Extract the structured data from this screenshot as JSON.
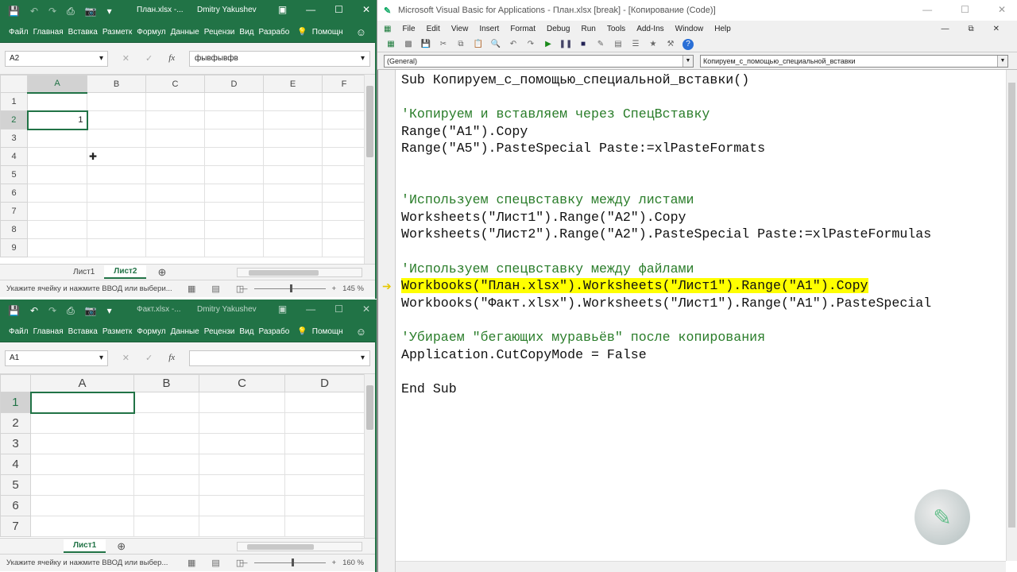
{
  "excel1": {
    "file": "План.xlsx -...",
    "user": "Dmitry Yakushev",
    "tabs": [
      "Файл",
      "Главная",
      "Вставка",
      "Разметк",
      "Формул",
      "Данные",
      "Рецензи",
      "Вид",
      "Разрабо"
    ],
    "tell": "Помощн",
    "namebox": "A2",
    "formula": "фывфывфв",
    "columns": [
      "A",
      "B",
      "C",
      "D",
      "E",
      "F"
    ],
    "rows": [
      "1",
      "2",
      "3",
      "4",
      "5",
      "6",
      "7",
      "8",
      "9"
    ],
    "a2": "1",
    "sheets": [
      "Лист1",
      "Лист2"
    ],
    "status": "Укажите ячейку и нажмите ВВОД или выбери...",
    "zoom": "145 %"
  },
  "excel2": {
    "file": "Факт.xlsx -...",
    "user": "Dmitry Yakushev",
    "tabs": [
      "Файл",
      "Главная",
      "Вставка",
      "Разметк",
      "Формул",
      "Данные",
      "Рецензи",
      "Вид",
      "Разрабо"
    ],
    "tell": "Помощн",
    "namebox": "A1",
    "formula": "",
    "columns": [
      "A",
      "B",
      "C",
      "D"
    ],
    "rows": [
      "1",
      "2",
      "3",
      "4",
      "5",
      "6",
      "7"
    ],
    "sheets": [
      "Лист1"
    ],
    "status": "Укажите ячейку и нажмите ВВОД или выбер...",
    "zoom": "160 %"
  },
  "vba": {
    "title": "Microsoft Visual Basic for Applications - План.xlsx [break] - [Копирование (Code)]",
    "menu": [
      "File",
      "Edit",
      "View",
      "Insert",
      "Format",
      "Debug",
      "Run",
      "Tools",
      "Add-Ins",
      "Window",
      "Help"
    ],
    "combo_left": "(General)",
    "combo_right": "Копируем_с_помощью_специальной_вставки",
    "code": [
      {
        "t": "Sub Копируем_с_помощью_специальной_вставки()",
        "s": "n"
      },
      {
        "t": "",
        "s": "n"
      },
      {
        "t": "'Копируем и вставляем через СпецВставку",
        "s": "c"
      },
      {
        "t": "Range(\"A1\").Copy",
        "s": "n"
      },
      {
        "t": "Range(\"A5\").PasteSpecial Paste:=xlPasteFormats",
        "s": "n"
      },
      {
        "t": "",
        "s": "n"
      },
      {
        "t": "",
        "s": "n"
      },
      {
        "t": "'Используем спецвставку между листами",
        "s": "c"
      },
      {
        "t": "Worksheets(\"Лист1\").Range(\"A2\").Copy",
        "s": "n"
      },
      {
        "t": "Worksheets(\"Лист2\").Range(\"A2\").PasteSpecial Paste:=xlPasteFormulas",
        "s": "n"
      },
      {
        "t": "",
        "s": "n"
      },
      {
        "t": "'Используем спецвставку между файлами",
        "s": "c"
      },
      {
        "t": "Workbooks(\"План.xlsx\").Worksheets(\"Лист1\").Range(\"A1\").Copy",
        "s": "h"
      },
      {
        "t": "Workbooks(\"Факт.xlsx\").Worksheets(\"Лист1\").Range(\"A1\").PasteSpecial",
        "s": "n"
      },
      {
        "t": "",
        "s": "n"
      },
      {
        "t": "'Убираем \"бегающих муравьёв\" после копирования",
        "s": "c"
      },
      {
        "t": "Application.CutCopyMode = False",
        "s": "n"
      },
      {
        "t": "",
        "s": "n"
      },
      {
        "t": "End Sub",
        "s": "n"
      }
    ]
  }
}
